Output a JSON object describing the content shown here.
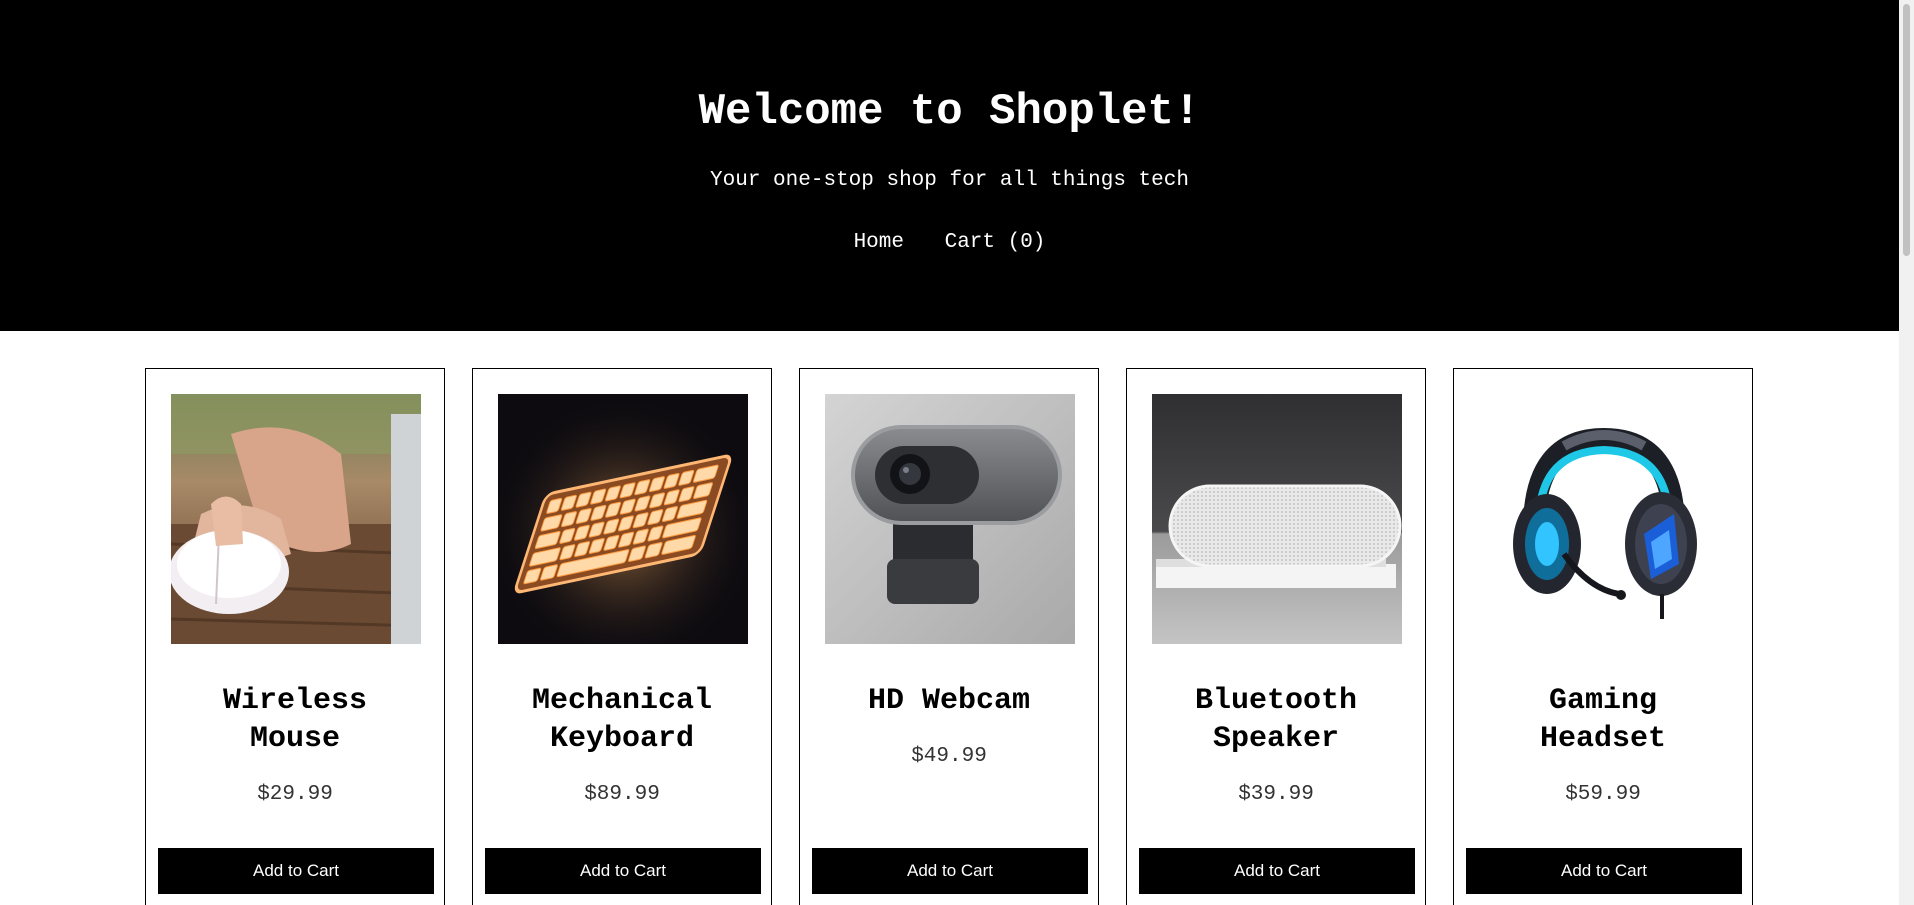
{
  "header": {
    "title": "Welcome to Shoplet!",
    "tagline": "Your one-stop shop for all things tech",
    "nav": {
      "home_label": "Home",
      "cart_label": "Cart (0)"
    }
  },
  "products": [
    {
      "name_line1": "Wireless",
      "name_line2": "Mouse",
      "price": "$29.99",
      "button_label": "Add to Cart",
      "image": "wireless-mouse-photo"
    },
    {
      "name_line1": "Mechanical",
      "name_line2": "Keyboard",
      "price": "$89.99",
      "button_label": "Add to Cart",
      "image": "mechanical-keyboard-photo"
    },
    {
      "name_line1": "HD Webcam",
      "name_line2": "",
      "price": "$49.99",
      "button_label": "Add to Cart",
      "image": "hd-webcam-photo"
    },
    {
      "name_line1": "Bluetooth",
      "name_line2": "Speaker",
      "price": "$39.99",
      "button_label": "Add to Cart",
      "image": "bluetooth-speaker-photo"
    },
    {
      "name_line1": "Gaming",
      "name_line2": "Headset",
      "price": "$59.99",
      "button_label": "Add to Cart",
      "image": "gaming-headset-photo"
    }
  ],
  "colors": {
    "header_bg": "#000000",
    "header_text": "#ffffff",
    "button_bg": "#000000",
    "button_text": "#ffffff",
    "card_border": "#000000"
  }
}
